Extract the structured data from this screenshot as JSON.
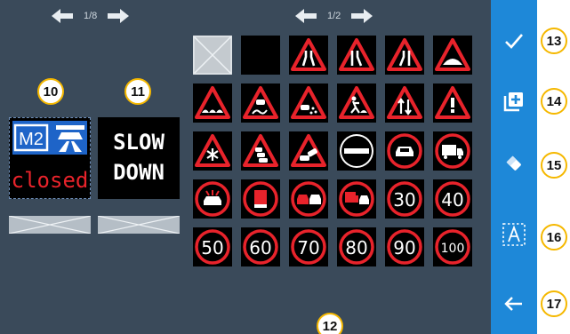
{
  "left": {
    "pager": "1/8",
    "callout_10": "10",
    "callout_11": "11",
    "preview_m2": {
      "badge": "M2",
      "status": "closed"
    },
    "preview_slow": {
      "line1": "SLOW",
      "line2": "DOWN"
    }
  },
  "middle": {
    "pager": "1/2",
    "callout_12": "12",
    "speed_limits": [
      "30",
      "40",
      "50",
      "60",
      "70",
      "80",
      "90",
      "100"
    ]
  },
  "toolbar": {
    "callouts": [
      "13",
      "14",
      "15",
      "16",
      "17"
    ],
    "icons": [
      "check-icon",
      "add-copy-icon",
      "eraser-icon",
      "text-select-icon",
      "back-arrow-icon"
    ]
  },
  "colors": {
    "panel": "#3a4a5a",
    "toolbar": "#1e88d8",
    "sign_red": "#e8232b",
    "callout_border": "#f5b800",
    "motorway_blue": "#1e64c8"
  }
}
